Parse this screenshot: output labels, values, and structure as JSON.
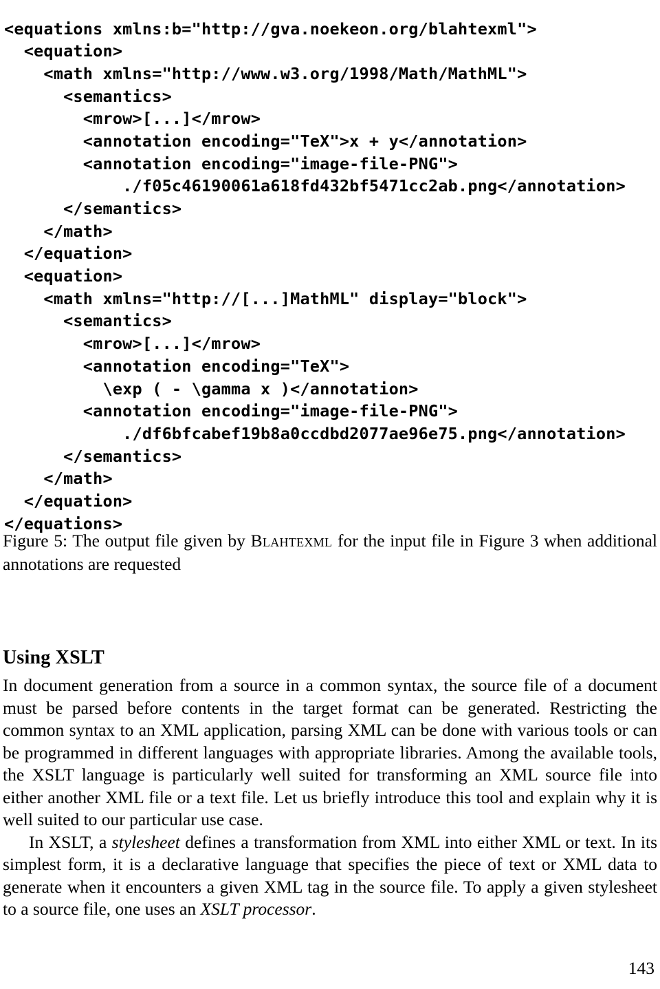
{
  "code_listing": {
    "name": "blahtexml-output-xml",
    "lines": [
      "<equations xmlns:b=\"http://gva.noekeon.org/blahtexml\">",
      "  <equation>",
      "    <math xmlns=\"http://www.w3.org/1998/Math/MathML\">",
      "      <semantics>",
      "        <mrow>[...]</mrow>",
      "        <annotation encoding=\"TeX\">x + y</annotation>",
      "        <annotation encoding=\"image-file-PNG\">",
      "            ./f05c46190061a618fd432bf5471cc2ab.png</annotation>",
      "      </semantics>",
      "    </math>",
      "  </equation>",
      "  <equation>",
      "    <math xmlns=\"http://[...]MathML\" display=\"block\">",
      "      <semantics>",
      "        <mrow>[...]</mrow>",
      "        <annotation encoding=\"TeX\">",
      "          \\exp ( - \\gamma x )</annotation>",
      "        <annotation encoding=\"image-file-PNG\">",
      "            ./df6bfcabef19b8a0ccdbd2077ae96e75.png</annotation>",
      "      </semantics>",
      "    </math>",
      "  </equation>",
      "</equations>"
    ]
  },
  "figure_caption": {
    "prefix": "Figure 5: The output file given by ",
    "smallcaps_name": "Blahtexml",
    "suffix": " for the input file in Figure 3 when additional annotations are requested"
  },
  "section": {
    "heading": "Using XSLT",
    "paragraph_1": "In document generation from a source in a common syntax, the source file of a document must be parsed before contents in the target format can be generated. Restricting the common syntax to an XML application, parsing XML can be done with various tools or can be programmed in different languages with appropriate libraries. Among the available tools, the XSLT language is particularly well suited for transforming an XML source file into either another XML file or a text file. Let us briefly introduce this tool and explain why it is well suited to our particular use case.",
    "paragraph_2_part_1": "In XSLT, a ",
    "paragraph_2_italic_1": "stylesheet",
    "paragraph_2_part_2": " defines a transformation from XML into either XML or text. In its simplest form, it is a declarative language that specifies the piece of text or XML data to generate when it encounters a given XML tag in the source file. To apply a given stylesheet to a source file, one uses an ",
    "paragraph_2_italic_2": "XSLT processor",
    "paragraph_2_part_3": "."
  },
  "footer": {
    "page_number": "143"
  }
}
